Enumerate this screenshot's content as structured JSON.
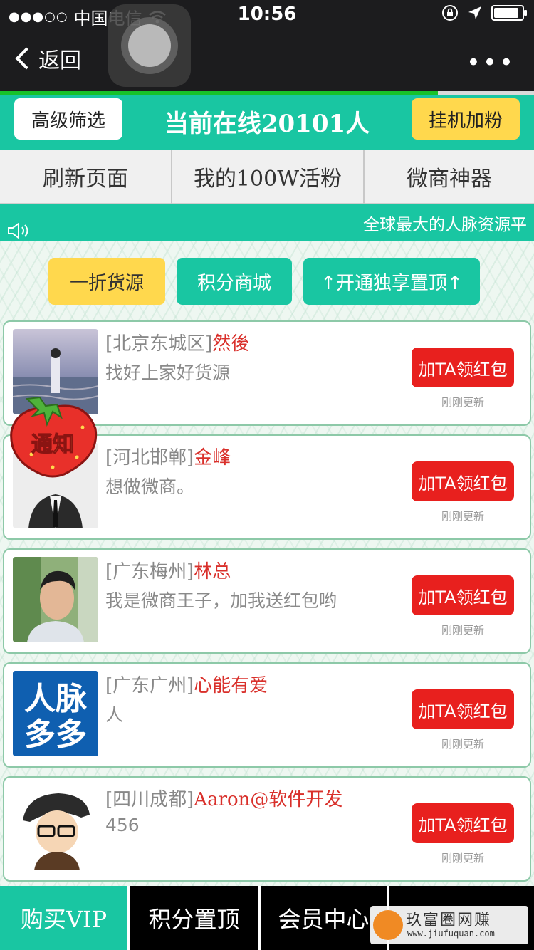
{
  "status_bar": {
    "signal": "●●●○○",
    "carrier": "中国电信",
    "time": "10:56"
  },
  "nav": {
    "back_label": "返回",
    "more_label": "•••"
  },
  "load_progress": 0.82,
  "header": {
    "filter_label": "高级筛选",
    "online_text": "当前在线20101人",
    "boost_label": "挂机加粉"
  },
  "menu": [
    "刷新页面",
    "我的100W活粉",
    "微商神器"
  ],
  "notice": "全球最大的人脉资源平",
  "pills": {
    "discount": "一折货源",
    "points_mall": "积分商城",
    "top_exclusive": "↑开通独享置顶↑"
  },
  "cards": [
    {
      "region": "[北京东城区]",
      "name": "然後",
      "desc": "找好上家好货源",
      "button": "加TA领红包",
      "updated": "刚刚更新"
    },
    {
      "region": "[河北邯郸]",
      "name": "金峰",
      "desc": "想做微商。",
      "button": "加TA领红包",
      "updated": "刚刚更新"
    },
    {
      "region": "[广东梅州]",
      "name": "林总",
      "desc": "我是微商王子，加我送红包哟",
      "button": "加TA领红包",
      "updated": "刚刚更新"
    },
    {
      "region": "[广东广州]",
      "name": "心能有爱",
      "desc": "人",
      "button": "加TA领红包",
      "updated": "刚刚更新"
    },
    {
      "region": "[四川成都]",
      "name": "Aaron@软件开发",
      "desc": "456",
      "button": "加TA领红包",
      "updated": "刚刚更新"
    }
  ],
  "strawberry_label": "通知",
  "avatar4_text": {
    "line1": "人脉",
    "line2": "多多"
  },
  "bottom_nav": [
    "购买VIP",
    "积分置顶",
    "会员中心",
    ""
  ],
  "watermark": {
    "text": "玖富圈网赚",
    "url": "www.jiufuquan.com"
  },
  "colors": {
    "accent": "#19c6a2",
    "red": "#e8201e",
    "yellow": "#ffd84d"
  }
}
